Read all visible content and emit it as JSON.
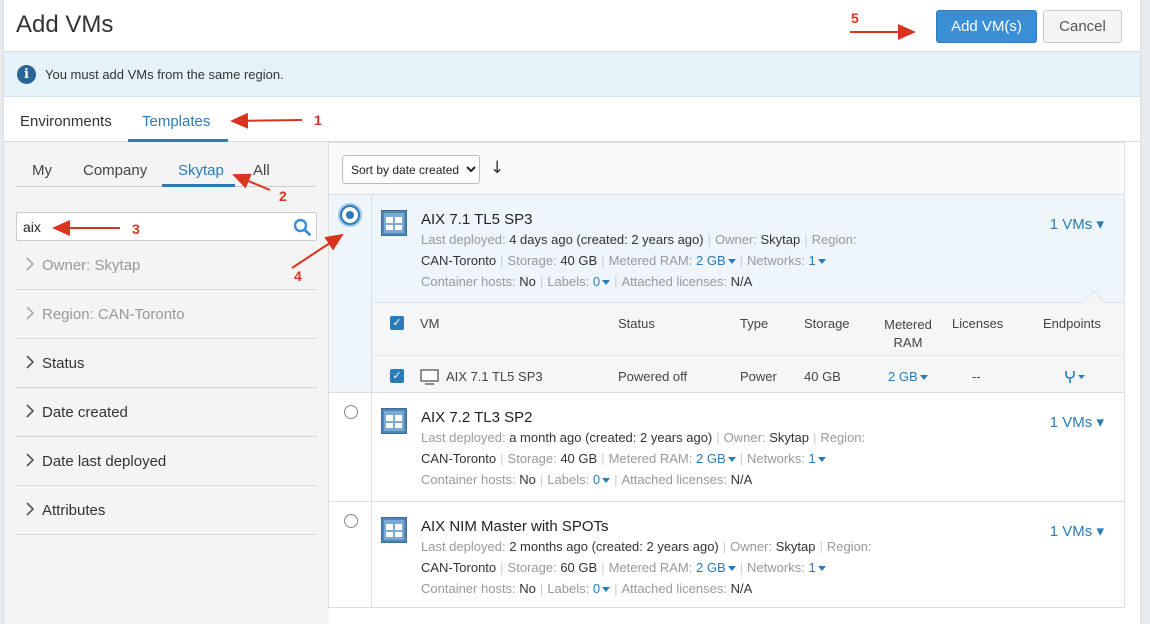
{
  "dialog": {
    "title": "Add VMs",
    "add_button": "Add VM(s)",
    "cancel_button": "Cancel"
  },
  "info": {
    "message": "You must add VMs from the same region."
  },
  "tabs": [
    {
      "label": "Environments",
      "active": false
    },
    {
      "label": "Templates",
      "active": true
    }
  ],
  "subtabs": [
    {
      "label": "My",
      "active": false
    },
    {
      "label": "Company",
      "active": false
    },
    {
      "label": "Skytap",
      "active": true
    },
    {
      "label": "All",
      "active": false
    }
  ],
  "search": {
    "value": "aix",
    "placeholder": ""
  },
  "facets": [
    {
      "label": "Owner:",
      "value": "Skytap",
      "dim": true
    },
    {
      "label": "Region:",
      "value": "CAN-Toronto",
      "dim": true
    },
    {
      "label": "Status",
      "value": "",
      "dim": false
    },
    {
      "label": "Date created",
      "value": "",
      "dim": false
    },
    {
      "label": "Date last deployed",
      "value": "",
      "dim": false
    },
    {
      "label": "Attributes",
      "value": "",
      "dim": false
    }
  ],
  "sort": {
    "selected": "Sort by date created",
    "options": [
      "Sort by date created"
    ]
  },
  "labels": {
    "last_deployed": "Last deployed:",
    "owner": "Owner:",
    "region": "Region:",
    "storage": "Storage:",
    "metered_ram": "Metered RAM:",
    "networks": "Networks:",
    "container_hosts": "Container hosts:",
    "labels": "Labels:",
    "attached_licenses": "Attached licenses:"
  },
  "templates": [
    {
      "name": "AIX 7.1 TL5 SP3",
      "vms": "1 VMs",
      "selected": true,
      "last_deployed": "4 days ago (created: 2 years ago)",
      "owner": "Skytap",
      "region": "CAN-Toronto",
      "storage": "40 GB",
      "metered_ram": "2 GB",
      "networks": "1",
      "container_hosts": "No",
      "labels": "0",
      "attached_licenses": "N/A"
    },
    {
      "name": "AIX 7.2 TL3 SP2",
      "vms": "1 VMs",
      "selected": false,
      "last_deployed": "a month ago (created: 2 years ago)",
      "owner": "Skytap",
      "region": "CAN-Toronto",
      "storage": "40 GB",
      "metered_ram": "2 GB",
      "networks": "1",
      "container_hosts": "No",
      "labels": "0",
      "attached_licenses": "N/A"
    },
    {
      "name": "AIX NIM Master with SPOTs",
      "vms": "1 VMs",
      "selected": false,
      "last_deployed": "2 months ago (created: 2 years ago)",
      "owner": "Skytap",
      "region": "CAN-Toronto",
      "storage": "60 GB",
      "metered_ram": "2 GB",
      "networks": "1",
      "container_hosts": "No",
      "labels": "0",
      "attached_licenses": "N/A"
    }
  ],
  "vm_table": {
    "headers": [
      "VM",
      "Status",
      "Type",
      "Storage",
      "Metered RAM",
      "Licenses",
      "Endpoints"
    ],
    "row": {
      "checked": true,
      "vm": "AIX 7.1 TL5 SP3",
      "status": "Powered off",
      "type": "Power",
      "storage": "40 GB",
      "metered_ram": "2 GB",
      "licenses": "--"
    }
  },
  "annotations": [
    "1",
    "2",
    "3",
    "4",
    "5"
  ],
  "colors": {
    "accent": "#2b7bb9",
    "annotation": "#d9341f",
    "info_bg": "#e6f2fa",
    "button": "#3a8fd4"
  },
  "icons": [
    "info-icon",
    "search-icon",
    "chevron-right-icon",
    "vm-template-icon",
    "monitor-icon",
    "endpoint-icon",
    "sort-direction-icon"
  ]
}
